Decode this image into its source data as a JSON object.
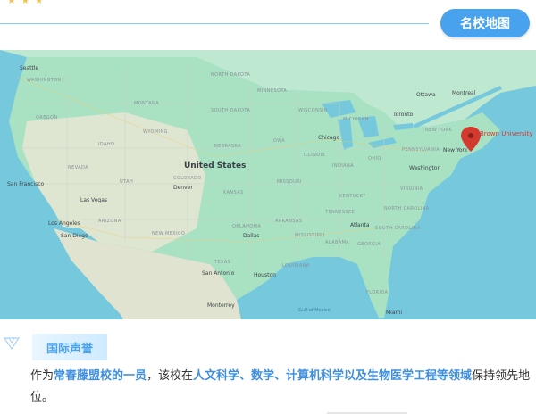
{
  "header": {
    "title": "名校地图",
    "stars": "★ ★ ★"
  },
  "map": {
    "country_label": "United States",
    "pin_label": "Brown University",
    "cities": [
      "Seattle",
      "San Francisco",
      "Los Angeles",
      "San Diego",
      "Las Vegas",
      "Denver",
      "Dallas",
      "Houston",
      "San Antonio",
      "Chicago",
      "Toronto",
      "Ottawa",
      "Montreal",
      "Boston",
      "New York",
      "Washington",
      "Atlanta",
      "Miami",
      "Monterrey"
    ],
    "states": [
      "WASHINGTON",
      "OREGON",
      "NEVADA",
      "UTAH",
      "ARIZONA",
      "NEW MEXICO",
      "COLORADO",
      "IDAHO",
      "MONTANA",
      "WYOMING",
      "NORTH DAKOTA",
      "SOUTH DAKOTA",
      "NEBRASKA",
      "KANSAS",
      "OKLAHOMA",
      "TEXAS",
      "MINNESOTA",
      "IOWA",
      "MISSOURI",
      "ARKANSAS",
      "LOUISIANA",
      "WISCONSIN",
      "MICHIGAN",
      "ILLINOIS",
      "INDIANA",
      "OHIO",
      "KENTUCKY",
      "TENNESSEE",
      "MISSISSIPPI",
      "ALABAMA",
      "GEORGIA",
      "FLORIDA",
      "NORTH CAROLINA",
      "SOUTH CAROLINA",
      "VIRGINIA",
      "PENNSYLVANIA",
      "NEW YORK"
    ],
    "water": [
      "Gulf of Mexico"
    ]
  },
  "section": {
    "tag": "国际声誉",
    "text_parts": [
      {
        "t": "作为",
        "hl": false
      },
      {
        "t": "常春藤盟校的一员",
        "hl": true
      },
      {
        "t": "，该校在",
        "hl": false
      },
      {
        "t": "人文科学、数学、计算机科学以及生物医学工程等领域",
        "hl": true
      },
      {
        "t": "保持领先地位。",
        "hl": false
      }
    ]
  },
  "colors": {
    "accent": "#48a2ee",
    "highlight": "#3f8fe0",
    "pin": "#d33a2f",
    "land": "#a9e2c3",
    "water": "#76c9dd"
  }
}
